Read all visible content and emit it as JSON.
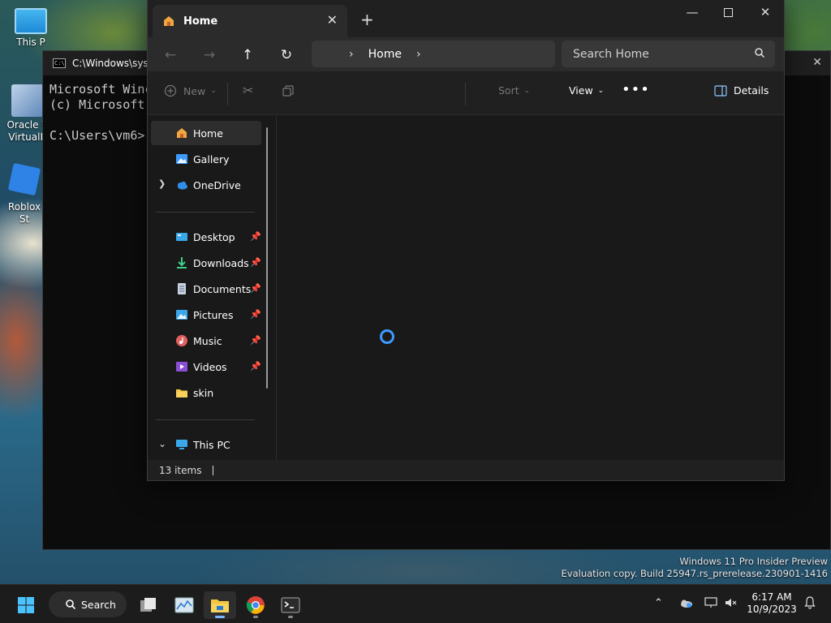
{
  "desktop": {
    "icons": [
      {
        "label": "This P"
      },
      {
        "label": "Oracle V\nVirtualB"
      },
      {
        "label": "Roblox St"
      }
    ]
  },
  "cmd": {
    "title": "C:\\Windows\\sys",
    "lines": [
      "Microsoft Winc",
      "(c) Microsoft ",
      "",
      "C:\\Users\\vm6>"
    ]
  },
  "explorer": {
    "tab_title": "Home",
    "address": {
      "segment": "Home"
    },
    "search_placeholder": "Search Home",
    "toolbar": {
      "new_label": "New",
      "sort_label": "Sort",
      "view_label": "View",
      "details_label": "Details"
    },
    "sidebar": {
      "top": [
        {
          "label": "Home",
          "icon": "home-icon"
        },
        {
          "label": "Gallery",
          "icon": "gallery-icon"
        },
        {
          "label": "OneDrive",
          "icon": "cloud-icon"
        }
      ],
      "quick": [
        {
          "label": "Desktop",
          "icon": "desktop-icon"
        },
        {
          "label": "Downloads",
          "icon": "downloads-icon"
        },
        {
          "label": "Documents",
          "icon": "documents-icon"
        },
        {
          "label": "Pictures",
          "icon": "pictures-icon"
        },
        {
          "label": "Music",
          "icon": "music-icon"
        },
        {
          "label": "Videos",
          "icon": "videos-icon"
        },
        {
          "label": "skin",
          "icon": "folder-icon"
        }
      ],
      "this_pc": "This PC"
    },
    "status": {
      "items": "13 items"
    }
  },
  "watermark": {
    "line1": "Windows 11 Pro Insider Preview",
    "line2": "Evaluation copy. Build 25947.rs_prerelease.230901-1416"
  },
  "taskbar": {
    "search_label": "Search",
    "time": "6:17 AM",
    "date": "10/9/2023"
  },
  "colors": {
    "accent": "#3d9bff",
    "folder": "#f4c542"
  }
}
